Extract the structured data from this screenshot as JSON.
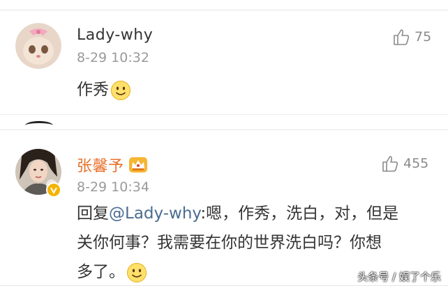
{
  "comments": [
    {
      "username": "Lady-why",
      "timestamp": "8-29 10:32",
      "likes": "75",
      "content": "作秀",
      "emoji_icon": "smiley-face-emoji",
      "avatar_icon": "cat-face-avatar"
    },
    {
      "username": "张馨予",
      "timestamp": "8-29 10:34",
      "likes": "455",
      "content_prefix": "回复",
      "mention": "@Lady-why",
      "content_line1": ":嗯，作秀，洗白，对，但是",
      "content_line2": "关你何事？我需要在你的世界洗白吗？你想",
      "content_line3": "多了。",
      "emoji_icon": "smiley-face-emoji",
      "avatar_icon": "woman-portrait-avatar",
      "badge_icon": "crown-vip-icon",
      "verified_icon": "verified-badge-icon",
      "username_color": "#e8722c"
    }
  ],
  "watermark": "头条号 / 娱了个乐"
}
